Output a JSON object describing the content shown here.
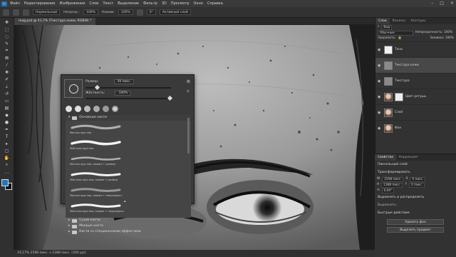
{
  "menu": {
    "logo": "Ps",
    "items": [
      "Файл",
      "Редактирование",
      "Изображение",
      "Слои",
      "Текст",
      "Выделение",
      "Фильтр",
      "3D",
      "Просмотр",
      "Окно",
      "Справка"
    ]
  },
  "options": {
    "mode": "Нормальный",
    "opacity_label": "Непрозр.:",
    "opacity": "100%",
    "flow_label": "Нажим:",
    "flow": "100%",
    "angle": "0°",
    "sample": "Активный слой"
  },
  "document": {
    "tab_title": "mag.psd @ 41,7% (Текстура кожи, RGB/8) *"
  },
  "status": {
    "text": "33,17%   2598 пикс. x 2388 пикс. (300 ppi)"
  },
  "brush_popup": {
    "size_label": "Размер:",
    "size_value": "39 пикс.",
    "hardness_label": "Жёсткость:",
    "hardness_value": "100%",
    "folders": {
      "general": "Основные кисти",
      "dry": "Сухие кисти",
      "wet": "Мокрые кисти",
      "special": "Кисти со специальными эффектами"
    },
    "brushes": [
      "Мягкая круглая",
      "Жёсткая круглая",
      "Мягкая круглая, нажим + размер",
      "Жёсткая круглая, нажим + размер",
      "Мягкая круглая, нажим + непрозрачн.",
      "Жёсткая круглая, нажим + непрозрачн."
    ]
  },
  "layers_panel": {
    "tabs": [
      "Слои",
      "Каналы",
      "Контуры"
    ],
    "search": "Вид",
    "blend": "Обычные",
    "opacity": "Непрозрачность: 100%",
    "lock": "Закрепить:",
    "fill": "Заливка: 100%",
    "layers": [
      {
        "name": "Тени",
        "thumb": "white"
      },
      {
        "name": "Текстура кожи",
        "thumb": "gray"
      },
      {
        "name": "Текстура",
        "thumb": "gray"
      },
      {
        "name": "Цвет ретушь",
        "thumb": "face"
      },
      {
        "name": "Слой",
        "thumb": "face"
      },
      {
        "name": "Фон",
        "thumb": "face"
      }
    ]
  },
  "properties_panel": {
    "tabs": [
      "Свойства",
      "Коррекция"
    ],
    "kind": "Пиксельный слой",
    "transform": "Трансформировать",
    "w": "2598 пикс.",
    "h": "2388 пикс.",
    "x": "0 пикс.",
    "y": "0 пикс.",
    "angle": "0,00°",
    "align": "Выровнять и распределить",
    "align_sub": "Выровнять:",
    "quick": "Быстрые действия",
    "btn1": "Удалить фон",
    "btn2": "Выделить предмет"
  }
}
